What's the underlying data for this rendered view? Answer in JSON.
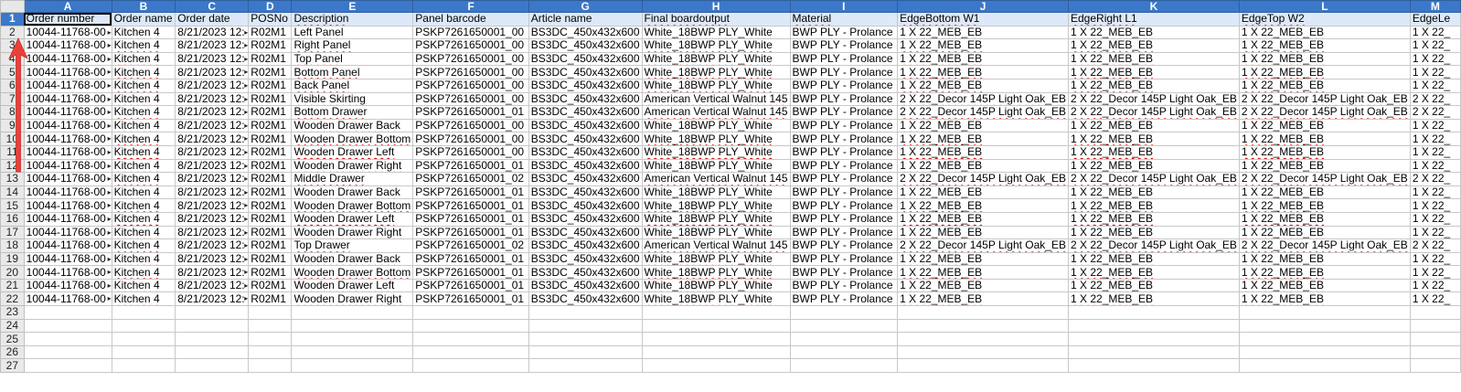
{
  "columns": [
    "A",
    "B",
    "C",
    "D",
    "E",
    "F",
    "G",
    "H",
    "I",
    "J",
    "K",
    "L",
    "M"
  ],
  "header_row": [
    "Order number",
    "Order name",
    "Order date",
    "POSNo",
    "Description",
    "Panel barcode",
    "Article name",
    "Final boardoutput",
    "Material",
    "EdgeBottom W1",
    "EdgeRight L1",
    "EdgeTop W2",
    "EdgeLe"
  ],
  "rows": [
    [
      "10044-11768-00",
      "Kitchen 4",
      "8/21/2023 12:",
      "R02M1",
      "Left Panel",
      "PSKP7261650001_00",
      "BS3DC_450x432x600",
      "White_18BWP PLY_White",
      "BWP PLY - Prolance",
      "1 X 22_MEB_EB",
      "1 X 22_MEB_EB",
      "1 X 22_MEB_EB",
      "1 X 22_"
    ],
    [
      "10044-11768-00",
      "Kitchen 4",
      "8/21/2023 12:",
      "R02M1",
      "Right Panel",
      "PSKP7261650001_00",
      "BS3DC_450x432x600",
      "White_18BWP PLY_White",
      "BWP PLY - Prolance",
      "1 X 22_MEB_EB",
      "1 X 22_MEB_EB",
      "1 X 22_MEB_EB",
      "1 X 22_"
    ],
    [
      "10044-11768-00",
      "Kitchen 4",
      "8/21/2023 12:",
      "R02M1",
      "Top Panel",
      "PSKP7261650001_00",
      "BS3DC_450x432x600",
      "White_18BWP PLY_White",
      "BWP PLY - Prolance",
      "1 X 22_MEB_EB",
      "1 X 22_MEB_EB",
      "1 X 22_MEB_EB",
      "1 X 22_"
    ],
    [
      "10044-11768-00",
      "Kitchen 4",
      "8/21/2023 12:",
      "R02M1",
      "Bottom Panel",
      "PSKP7261650001_00",
      "BS3DC_450x432x600",
      "White_18BWP PLY_White",
      "BWP PLY - Prolance",
      "1 X 22_MEB_EB",
      "1 X 22_MEB_EB",
      "1 X 22_MEB_EB",
      "1 X 22_"
    ],
    [
      "10044-11768-00",
      "Kitchen 4",
      "8/21/2023 12:",
      "R02M1",
      "Back Panel",
      "PSKP7261650001_00",
      "BS3DC_450x432x600",
      "White_18BWP PLY_White",
      "BWP PLY - Prolance",
      "1 X 22_MEB_EB",
      "1 X 22_MEB_EB",
      "1 X 22_MEB_EB",
      "1 X 22_"
    ],
    [
      "10044-11768-00",
      "Kitchen 4",
      "8/21/2023 12:",
      "R02M1",
      "Visible Skirting",
      "PSKP7261650001_00",
      "BS3DC_450x432x600",
      "American Vertical Walnut 145",
      "BWP PLY - Prolance",
      "2 X 22_Decor 145P Light Oak_EB",
      "2 X 22_Decor 145P Light Oak_EB",
      "2 X 22_Decor 145P Light Oak_EB",
      "2 X 22_"
    ],
    [
      "10044-11768-00",
      "Kitchen 4",
      "8/21/2023 12:",
      "R02M1",
      "Bottom Drawer",
      "PSKP7261650001_01",
      "BS3DC_450x432x600",
      "American Vertical Walnut 145",
      "BWP PLY - Prolance",
      "2 X 22_Decor 145P Light Oak_EB",
      "2 X 22_Decor 145P Light Oak_EB",
      "2 X 22_Decor 145P Light Oak_EB",
      "2 X 22_"
    ],
    [
      "10044-11768-00",
      "Kitchen 4",
      "8/21/2023 12:",
      "R02M1",
      "Wooden Drawer Back",
      "PSKP7261650001_00",
      "BS3DC_450x432x600",
      "White_18BWP PLY_White",
      "BWP PLY - Prolance",
      "1 X 22_MEB_EB",
      "1 X 22_MEB_EB",
      "1 X 22_MEB_EB",
      "1 X 22_"
    ],
    [
      "10044-11768-00",
      "Kitchen 4",
      "8/21/2023 12:",
      "R02M1",
      "Wooden Drawer Bottom",
      "PSKP7261650001_00",
      "BS3DC_450x432x600",
      "White_18BWP PLY_White",
      "BWP PLY - Prolance",
      "1 X 22_MEB_EB",
      "1 X 22_MEB_EB",
      "1 X 22_MEB_EB",
      "1 X 22_"
    ],
    [
      "10044-11768-00",
      "Kitchen 4",
      "8/21/2023 12:",
      "R02M1",
      "Wooden Drawer Left",
      "PSKP7261650001_00",
      "BS3DC_450x432x600",
      "White_18BWP PLY_White",
      "BWP PLY - Prolance",
      "1 X 22_MEB_EB",
      "1 X 22_MEB_EB",
      "1 X 22_MEB_EB",
      "1 X 22_"
    ],
    [
      "10044-11768-00",
      "Kitchen 4",
      "8/21/2023 12:",
      "R02M1",
      "Wooden Drawer Right",
      "PSKP7261650001_01",
      "BS3DC_450x432x600",
      "White_18BWP PLY_White",
      "BWP PLY - Prolance",
      "1 X 22_MEB_EB",
      "1 X 22_MEB_EB",
      "1 X 22_MEB_EB",
      "1 X 22_"
    ],
    [
      "10044-11768-00",
      "Kitchen 4",
      "8/21/2023 12:",
      "R02M1",
      "Middle Drawer",
      "PSKP7261650001_02",
      "BS3DC_450x432x600",
      "American Vertical Walnut 145",
      "BWP PLY - Prolance",
      "2 X 22_Decor 145P Light Oak_EB",
      "2 X 22_Decor 145P Light Oak_EB",
      "2 X 22_Decor 145P Light Oak_EB",
      "2 X 22_"
    ],
    [
      "10044-11768-00",
      "Kitchen 4",
      "8/21/2023 12:",
      "R02M1",
      "Wooden Drawer Back",
      "PSKP7261650001_01",
      "BS3DC_450x432x600",
      "White_18BWP PLY_White",
      "BWP PLY - Prolance",
      "1 X 22_MEB_EB",
      "1 X 22_MEB_EB",
      "1 X 22_MEB_EB",
      "1 X 22_"
    ],
    [
      "10044-11768-00",
      "Kitchen 4",
      "8/21/2023 12:",
      "R02M1",
      "Wooden Drawer Bottom",
      "PSKP7261650001_01",
      "BS3DC_450x432x600",
      "White_18BWP PLY_White",
      "BWP PLY - Prolance",
      "1 X 22_MEB_EB",
      "1 X 22_MEB_EB",
      "1 X 22_MEB_EB",
      "1 X 22_"
    ],
    [
      "10044-11768-00",
      "Kitchen 4",
      "8/21/2023 12:",
      "R02M1",
      "Wooden Drawer Left",
      "PSKP7261650001_01",
      "BS3DC_450x432x600",
      "White_18BWP PLY_White",
      "BWP PLY - Prolance",
      "1 X 22_MEB_EB",
      "1 X 22_MEB_EB",
      "1 X 22_MEB_EB",
      "1 X 22_"
    ],
    [
      "10044-11768-00",
      "Kitchen 4",
      "8/21/2023 12:",
      "R02M1",
      "Wooden Drawer Right",
      "PSKP7261650001_01",
      "BS3DC_450x432x600",
      "White_18BWP PLY_White",
      "BWP PLY - Prolance",
      "1 X 22_MEB_EB",
      "1 X 22_MEB_EB",
      "1 X 22_MEB_EB",
      "1 X 22_"
    ],
    [
      "10044-11768-00",
      "Kitchen 4",
      "8/21/2023 12:",
      "R02M1",
      "Top Drawer",
      "PSKP7261650001_02",
      "BS3DC_450x432x600",
      "American Vertical Walnut 145",
      "BWP PLY - Prolance",
      "2 X 22_Decor 145P Light Oak_EB",
      "2 X 22_Decor 145P Light Oak_EB",
      "2 X 22_Decor 145P Light Oak_EB",
      "2 X 22_"
    ],
    [
      "10044-11768-00",
      "Kitchen 4",
      "8/21/2023 12:",
      "R02M1",
      "Wooden Drawer Back",
      "PSKP7261650001_01",
      "BS3DC_450x432x600",
      "White_18BWP PLY_White",
      "BWP PLY - Prolance",
      "1 X 22_MEB_EB",
      "1 X 22_MEB_EB",
      "1 X 22_MEB_EB",
      "1 X 22_"
    ],
    [
      "10044-11768-00",
      "Kitchen 4",
      "8/21/2023 12:",
      "R02M1",
      "Wooden Drawer Bottom",
      "PSKP7261650001_01",
      "BS3DC_450x432x600",
      "White_18BWP PLY_White",
      "BWP PLY - Prolance",
      "1 X 22_MEB_EB",
      "1 X 22_MEB_EB",
      "1 X 22_MEB_EB",
      "1 X 22_"
    ],
    [
      "10044-11768-00",
      "Kitchen 4",
      "8/21/2023 12:",
      "R02M1",
      "Wooden Drawer Left",
      "PSKP7261650001_01",
      "BS3DC_450x432x600",
      "White_18BWP PLY_White",
      "BWP PLY - Prolance",
      "1 X 22_MEB_EB",
      "1 X 22_MEB_EB",
      "1 X 22_MEB_EB",
      "1 X 22_"
    ],
    [
      "10044-11768-00",
      "Kitchen 4",
      "8/21/2023 12:",
      "R02M1",
      "Wooden Drawer Right",
      "PSKP7261650001_01",
      "BS3DC_450x432x600",
      "White_18BWP PLY_White",
      "BWP PLY - Prolance",
      "1 X 22_MEB_EB",
      "1 X 22_MEB_EB",
      "1 X 22_MEB_EB",
      "1 X 22_"
    ]
  ],
  "empty_row_numbers": [
    "23",
    "24",
    "25",
    "26",
    "27"
  ],
  "row_numbers": [
    "1",
    "2",
    "3",
    "4",
    "5",
    "6",
    "7",
    "8",
    "9",
    "10",
    "11",
    "12",
    "13",
    "14",
    "15",
    "16",
    "17",
    "18",
    "19",
    "20",
    "21",
    "22"
  ],
  "selected_row": "1",
  "annotation": {
    "icon": "red-up-arrow-icon",
    "color": "#e8413a"
  },
  "colors": {
    "header_bg": "#3c78c9",
    "selected_row_bg": "#dde9f8",
    "spell_underline": "#d00000"
  }
}
